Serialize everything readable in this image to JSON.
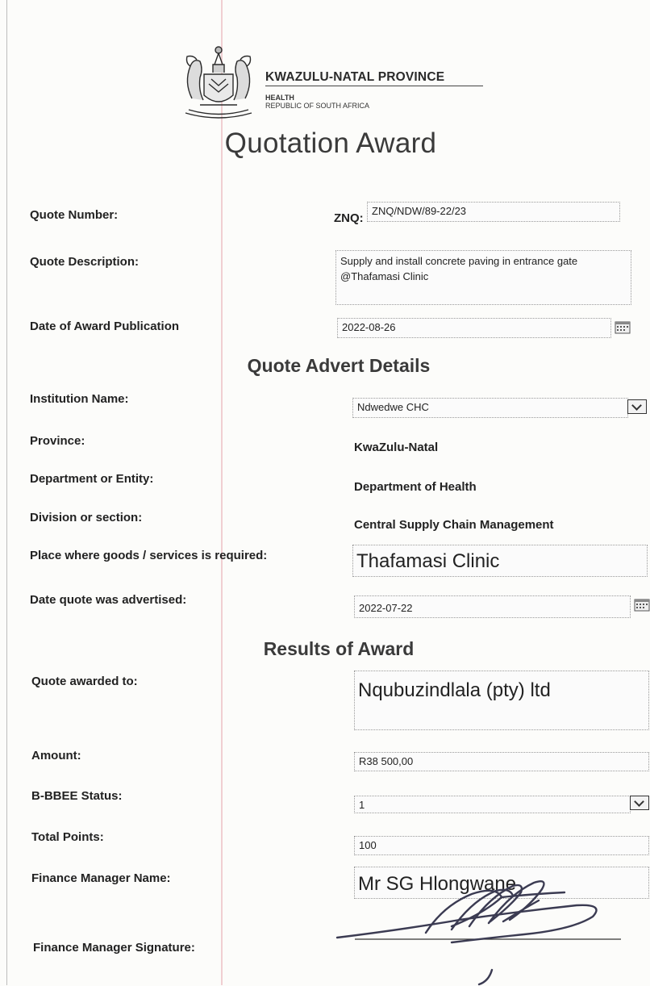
{
  "header": {
    "province_name": "KWAZULU-NATAL PROVINCE",
    "sub_line1": "HEALTH",
    "sub_line2": "REPUBLIC OF SOUTH AFRICA",
    "title": "Quotation Award"
  },
  "quote": {
    "number_label": "Quote Number:",
    "number_prefix": "ZNQ:",
    "number_value": "ZNQ/NDW/89-22/23",
    "description_label": "Quote Description:",
    "description_value": "Supply and install concrete paving in entrance gate @Thafamasi Clinic",
    "award_date_label": "Date of Award Publication",
    "award_date_value": "2022-08-26"
  },
  "advert": {
    "heading": "Quote Advert Details",
    "institution_label": "Institution Name:",
    "institution_value": "Ndwedwe CHC",
    "province_label": "Province:",
    "province_value": "KwaZulu-Natal",
    "department_label": "Department or Entity:",
    "department_value": "Department of Health",
    "division_label": "Division or section:",
    "division_value": "Central Supply Chain Management",
    "place_label": "Place where goods /  services is required:",
    "place_value": "Thafamasi Clinic",
    "advertised_label": "Date quote was advertised:",
    "advertised_value": "2022-07-22"
  },
  "results": {
    "heading": "Results of Award",
    "awarded_to_label": "Quote awarded to:",
    "awarded_to_value": "Nqubuzindlala (pty) ltd",
    "amount_label": "Amount:",
    "amount_value": "R38 500,00",
    "bbbee_label": "B-BBEE Status:",
    "bbbee_value": "1",
    "points_label": "Total Points:",
    "points_value": "100",
    "fm_name_label": "Finance Manager Name:",
    "fm_name_value": "Mr SG Hlongwane",
    "fm_signature_label": "Finance Manager Signature:"
  }
}
